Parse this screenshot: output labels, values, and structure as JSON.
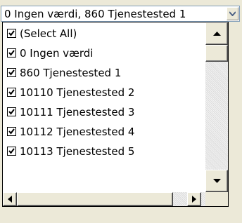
{
  "combo": {
    "value": "0  Ingen værdi, 860  Tjenestested 1",
    "dropdown_icon": "chevron-down-icon"
  },
  "list": {
    "items": [
      {
        "label": "(Select All)",
        "checked": true
      },
      {
        "label": "0  Ingen værdi",
        "checked": true
      },
      {
        "label": "860  Tjenestested 1",
        "checked": true
      },
      {
        "label": "10110  Tjenestested 2",
        "checked": true
      },
      {
        "label": "10111  Tjenestested 3",
        "checked": true
      },
      {
        "label": "10112  Tjenestested 4",
        "checked": true
      },
      {
        "label": "10113  Tjenestested 5",
        "checked": true
      }
    ]
  },
  "icons": {
    "scroll_up": "arrow-up-icon",
    "scroll_down": "arrow-down-icon",
    "scroll_left": "arrow-left-icon",
    "scroll_right": "arrow-right-icon",
    "checkmark": "checkmark-icon"
  }
}
